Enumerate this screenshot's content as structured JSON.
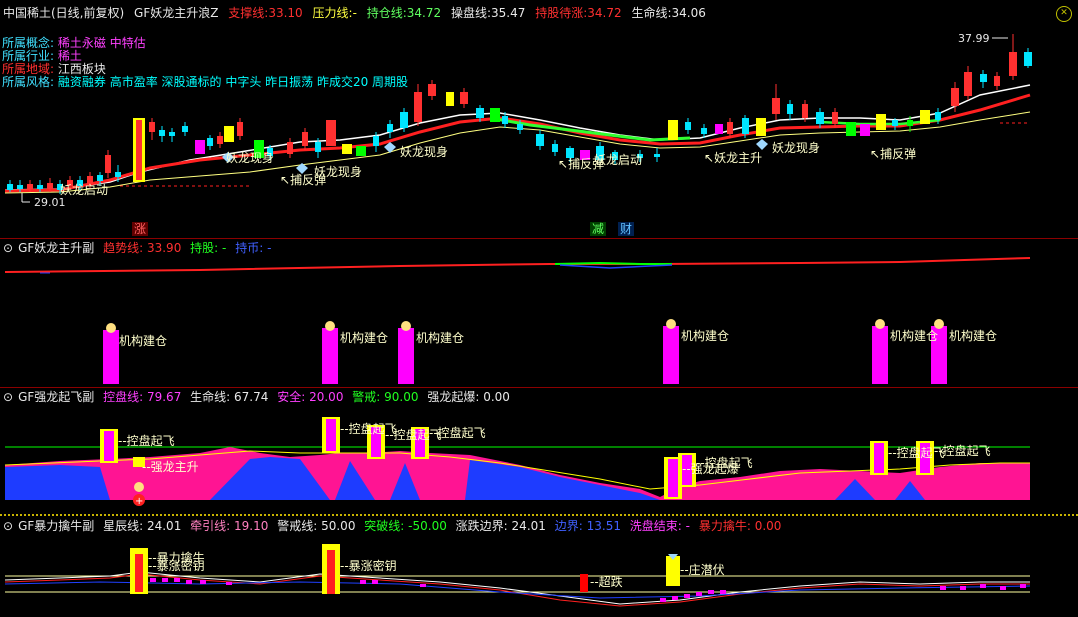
{
  "header": {
    "stock": "中国稀土(日线,前复权)",
    "indicator_name": "GF妖龙主升浪Z",
    "support_label": "支撑线:",
    "support_val": "33.10",
    "pressure_label": "压力线:",
    "pressure_val": "-",
    "position_label": "持仓线:",
    "position_val": "34.72",
    "trade_label": "操盘线:",
    "trade_val": "35.47",
    "hold_label": "持股待涨:",
    "hold_val": "34.72",
    "life_label": "生命线:",
    "life_val": "34.06"
  },
  "info": {
    "concept_label": "所属概念:",
    "concept_val": "稀土永磁 中特估",
    "industry_label": "所属行业:",
    "industry_val": "稀土",
    "region_label": "所属地域:",
    "region_val": "江西板块",
    "style_label": "所属风格:",
    "style_val": "融资融券 高市盈率 深股通标的 中字头 昨日振荡 昨成交20 周期股"
  },
  "main_chart": {
    "high_price": "37.99",
    "low_price": "29.01",
    "labels": {
      "yaolong_qidong": "妖龙启动",
      "yaolong_xianshen": "妖龙现身",
      "bufantan": "捕反弹",
      "yaolong_zhusheng": "妖龙主升",
      "zhang": "涨",
      "jian": "减",
      "cai": "财"
    }
  },
  "panel2": {
    "name": "GF妖龙主升副",
    "trend_label": "趋势线:",
    "trend_val": "33.90",
    "hold_label": "持股:",
    "hold_val": "-",
    "coin_label": "持币:",
    "coin_val": "-",
    "signal_label": "机构建仓"
  },
  "panel3": {
    "name": "GF强龙起飞副",
    "control_label": "控盘线:",
    "control_val": "79.67",
    "life_label": "生命线:",
    "life_val": "67.74",
    "safe_label": "安全:",
    "safe_val": "20.00",
    "alert_label": "警戒:",
    "alert_val": "90.00",
    "burst_label": "强龙起爆:",
    "burst_val": "0.00",
    "sig_kongpan": "控盘起飞",
    "sig_qianglong": "强龙主升",
    "sig_qianglong_qibao": "强龙起爆"
  },
  "panel4": {
    "name": "GF暴力擒牛副",
    "star_label": "星辰线:",
    "star_val": "24.01",
    "traction_label": "牵引线:",
    "traction_val": "19.10",
    "alert_label": "警戒线:",
    "alert_val": "50.00",
    "break_label": "突破线:",
    "break_val": "-50.00",
    "edge_label": "涨跌边界:",
    "edge_val": "24.01",
    "bound_label": "边界:",
    "bound_val": "13.51",
    "wash_label": "洗盘结束:",
    "wash_val": "-",
    "bull_label": "暴力擒牛:",
    "bull_val": "0.00",
    "sig_baoli": "暴力擒牛",
    "sig_baozhang": "暴涨密钥",
    "sig_chaodie": "超跌",
    "sig_zhuang": "庄潜伏"
  },
  "colors": {
    "bg": "#000000",
    "up": "#ff3030",
    "down": "#00e5ff",
    "magenta": "#ff00ff",
    "blue": "#2040ff",
    "yellow": "#ffff00",
    "green": "#00ff00"
  }
}
